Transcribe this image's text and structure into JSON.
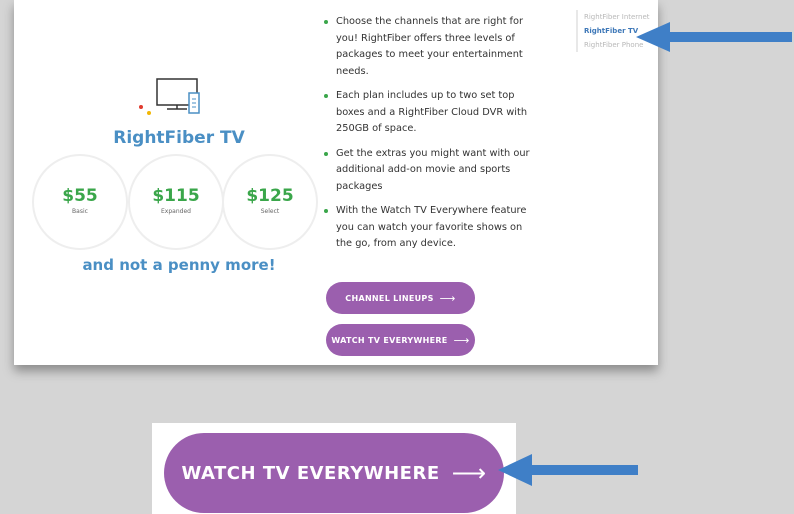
{
  "product": {
    "title": "RightFiber TV",
    "tagline": "and not a penny more!"
  },
  "plans": [
    {
      "price": "$55",
      "tier": "Basic"
    },
    {
      "price": "$115",
      "tier": "Expanded"
    },
    {
      "price": "$125",
      "tier": "Select"
    }
  ],
  "bullets": [
    "Choose the channels that are right for you! RightFiber offers three levels of packages to meet your entertainment needs.",
    "Each plan includes up to two set top boxes and a RightFiber Cloud DVR with 250GB of space.",
    "Get the extras you might want with our additional add-on movie and sports packages",
    "With the Watch TV Everywhere feature you can watch your favorite shows on the go, from any device."
  ],
  "buttons": {
    "channel_lineups": "CHANNEL LINEUPS",
    "watch_tv": "WATCH TV EVERYWHERE",
    "arrow": "⟶"
  },
  "sidenav": {
    "items": [
      "RightFiber Internet",
      "RightFiber TV",
      "RightFiber Phone"
    ],
    "active": "RightFiber TV"
  },
  "zoom": {
    "label": "WATCH TV EVERYWHERE",
    "arrow": "⟶"
  },
  "colors": {
    "accent_blue": "#4a8fc4",
    "price_green": "#3aa64a",
    "button_purple": "#9b5fae",
    "annotation_arrow": "#3f7fc7"
  }
}
